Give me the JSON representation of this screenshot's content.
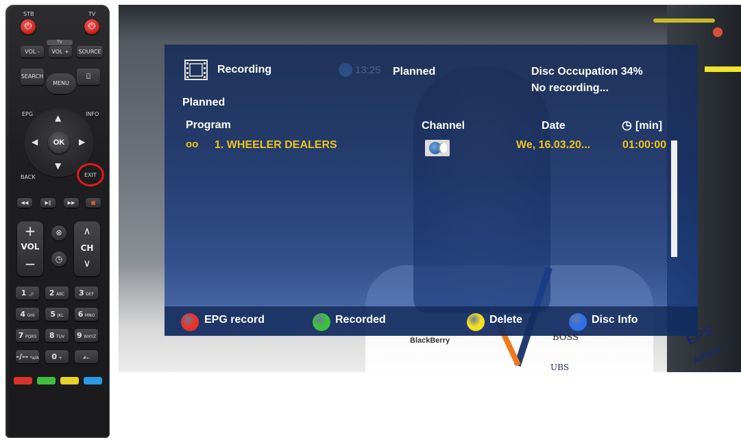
{
  "remote": {
    "stb_label": "STB",
    "tv_label": "TV",
    "tv_bar_label": "TV",
    "vol_minus": "VOL -",
    "vol_plus": "VOL +",
    "source": "SOURCE",
    "search": "SEARCH",
    "menu": "MENU",
    "epg": "EPG",
    "info": "INFO",
    "ok": "OK",
    "back": "BACK",
    "exit": "EXIT",
    "vol": "VOL",
    "ch": "CH",
    "keys": [
      {
        "n": "1",
        "l": ".,/!"
      },
      {
        "n": "2",
        "l": "ABC"
      },
      {
        "n": "3",
        "l": "DEF"
      },
      {
        "n": "4",
        "l": "GHI"
      },
      {
        "n": "5",
        "l": "JKL"
      },
      {
        "n": "6",
        "l": "MNO"
      },
      {
        "n": "7",
        "l": "PQRS"
      },
      {
        "n": "8",
        "l": "TUV"
      },
      {
        "n": "9",
        "l": "WXYZ"
      },
      {
        "n": "-/--",
        "l": "*a/A"
      },
      {
        "n": "0",
        "l": "+"
      },
      {
        "n": "",
        "l": "#←"
      }
    ],
    "color_keys": [
      "#d8322c",
      "#3fbf3c",
      "#e4d12a",
      "#2a9be0"
    ],
    "highlight_color": "#e0191f"
  },
  "tv": {
    "header": {
      "title": "Recording",
      "time": "13:25",
      "status": "Planned",
      "disc_occupation": "Disc Occupation 34%",
      "no_recording": "No recording..."
    },
    "section": "Planned",
    "columns": {
      "program": "Program",
      "channel": "Channel",
      "date": "Date",
      "duration": "[min]"
    },
    "rows": [
      {
        "program": "1. WHEELER DEALERS",
        "date": "We, 16.03.20...",
        "duration": "01:00:00"
      }
    ],
    "function_keys": [
      {
        "color": "#e8332c",
        "label": "EPG record"
      },
      {
        "color": "#3dc23d",
        "label": "Recorded"
      },
      {
        "color": "#f1e022",
        "label": "Delete"
      },
      {
        "color": "#2f6fe8",
        "label": "Disc Info"
      }
    ],
    "background_text": {
      "blackberry": "BlackBerry",
      "boss": "BOSS",
      "ubs": "UBS",
      "epson": "EPS",
      "allianz": "Allianz"
    }
  }
}
